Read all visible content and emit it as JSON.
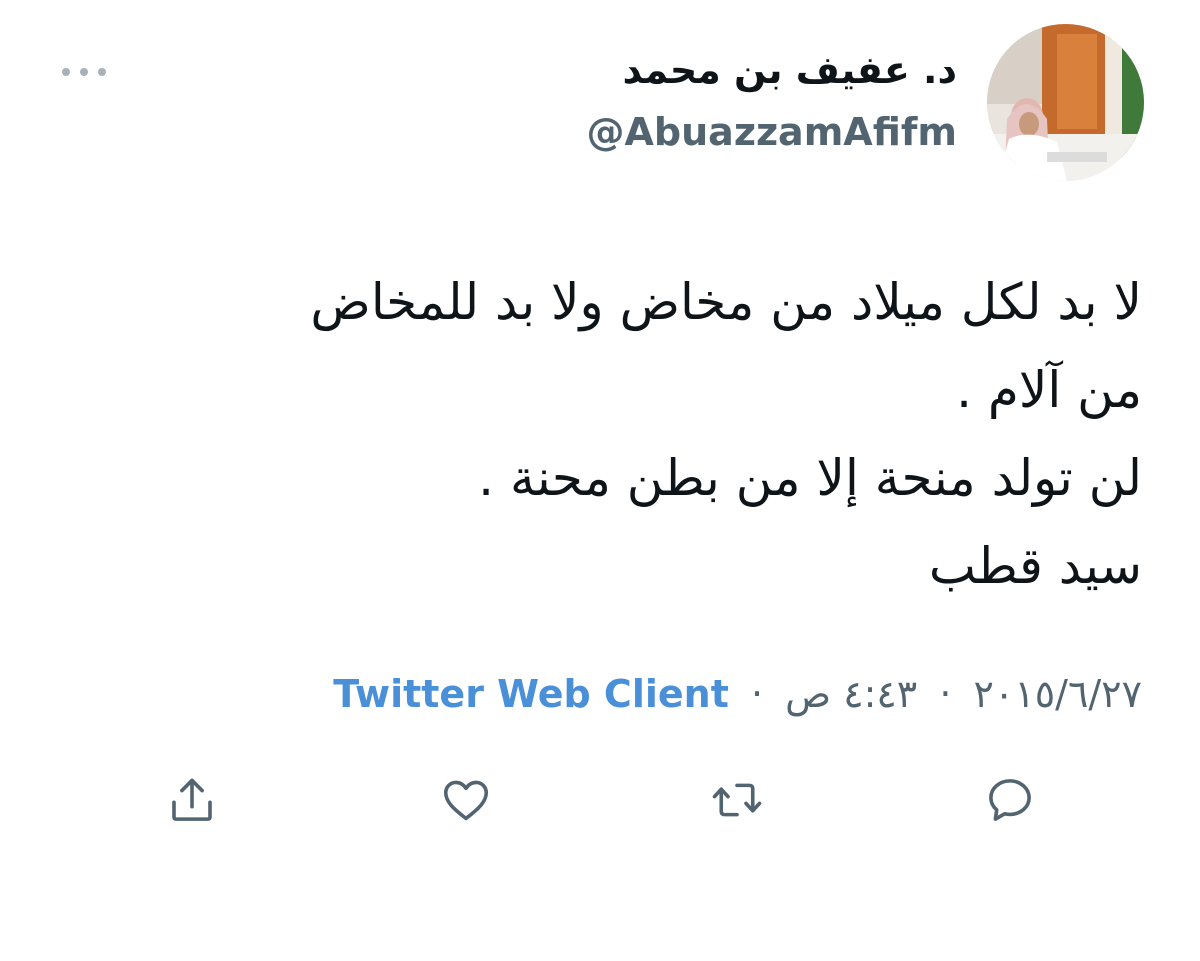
{
  "tweet": {
    "author_name": "د. عفيف بن محمد",
    "author_handle": "@AbuazzamAfifm",
    "text_lines": [
      "لا بد لكل ميلاد من مخاض ولا بد للمخاض",
      "من آلام .",
      "لن تولد منحة إلا من بطن محنة .",
      "سيد قطب"
    ],
    "date": "٢٠١٥/٦/٢٧",
    "time": "٤:٤٣ ص",
    "source": "Twitter Web Client",
    "separator": "·"
  },
  "icons": {
    "more": "more-dots-icon",
    "reply": "reply-icon",
    "retweet": "retweet-icon",
    "like": "heart-icon",
    "share": "share-icon"
  },
  "colors": {
    "text": "#0f1419",
    "secondary": "#536471",
    "link": "#4a90d9",
    "icon": "#536471"
  }
}
